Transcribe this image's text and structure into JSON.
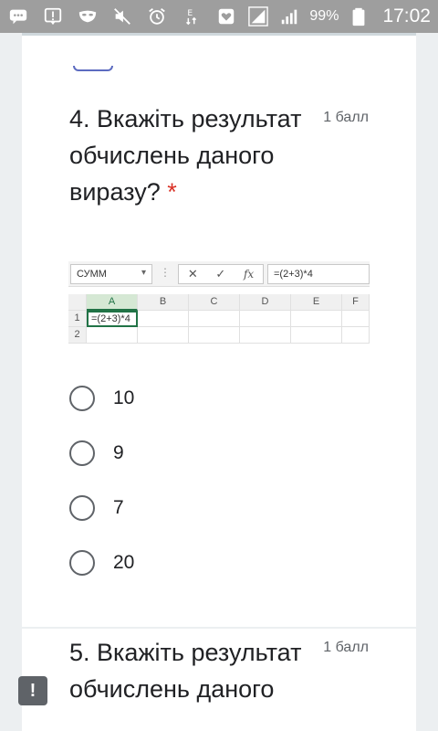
{
  "status_bar": {
    "battery_percent": "99%",
    "time": "17:02",
    "icons": [
      "chat-icon",
      "alert-icon",
      "mask-icon",
      "mute-icon",
      "alarm-icon",
      "data-e-icon",
      "heart-icon",
      "signal-icon",
      "signal-icon",
      "battery-icon"
    ]
  },
  "question4": {
    "title": "4. Вкажіть результат обчислень даного виразу?",
    "required_mark": "*",
    "points": "1 балл",
    "sheet": {
      "name_box": "СУММ",
      "formula": "=(2+3)*4",
      "fx": "fx",
      "columns": [
        "A",
        "B",
        "C",
        "D",
        "E",
        "F"
      ],
      "rows": [
        "1",
        "2"
      ],
      "active_cell_value": "=(2+3)*4"
    },
    "options": [
      "10",
      "9",
      "7",
      "20"
    ]
  },
  "question5": {
    "title": "5. Вкажіть результат обчислень даного",
    "points": "1 балл"
  },
  "colors": {
    "status_bar": "#9e9e9e",
    "background": "#eceff1",
    "required": "#d93025",
    "excel_green": "#217346"
  }
}
